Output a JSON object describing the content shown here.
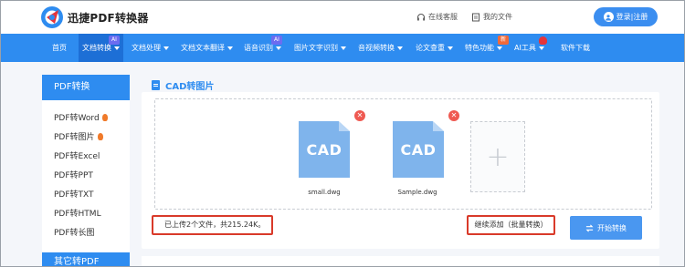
{
  "header": {
    "logo_text": "迅捷PDF转换器",
    "service_label": "在线客服",
    "files_label": "我的文件",
    "login_label": "登录|注册"
  },
  "nav": {
    "items": [
      {
        "label": "首页",
        "dropdown": false
      },
      {
        "label": "文档转换",
        "dropdown": true,
        "badge": "AI",
        "active": true
      },
      {
        "label": "文档处理",
        "dropdown": true
      },
      {
        "label": "文档文本翻译",
        "dropdown": true
      },
      {
        "label": "语音识别",
        "dropdown": true,
        "badge": "AI"
      },
      {
        "label": "图片文字识别",
        "dropdown": true
      },
      {
        "label": "音视频转换",
        "dropdown": true
      },
      {
        "label": "论文查重",
        "dropdown": true
      },
      {
        "label": "特色功能",
        "dropdown": true,
        "badge": "新"
      },
      {
        "label": "AI工具",
        "dropdown": true,
        "badge": "hot"
      },
      {
        "label": "软件下载",
        "dropdown": false
      }
    ]
  },
  "sidebar": {
    "heading": "PDF转换",
    "items": [
      {
        "label": "PDF转Word",
        "hot": true
      },
      {
        "label": "PDF转图片",
        "hot": true
      },
      {
        "label": "PDF转Excel",
        "hot": false
      },
      {
        "label": "PDF转PPT",
        "hot": false
      },
      {
        "label": "PDF转TXT",
        "hot": false
      },
      {
        "label": "PDF转HTML",
        "hot": false
      },
      {
        "label": "PDF转长图",
        "hot": false
      }
    ],
    "heading2": "其它转PDF"
  },
  "main": {
    "title": "CAD转图片",
    "files": [
      {
        "ext": "CAD",
        "name": "small.dwg"
      },
      {
        "ext": "CAD",
        "name": "Sample.dwg"
      }
    ],
    "add_symbol": "+",
    "status_text": "已上传2个文件，共215.24K。",
    "more_label": "继续添加（批量转换）",
    "start_label": "开始转换"
  },
  "colors": {
    "primary": "#2e8cf0",
    "highlight": "#d93a2a",
    "file_icon": "#7fb4ec",
    "delete": "#ef5a52"
  }
}
